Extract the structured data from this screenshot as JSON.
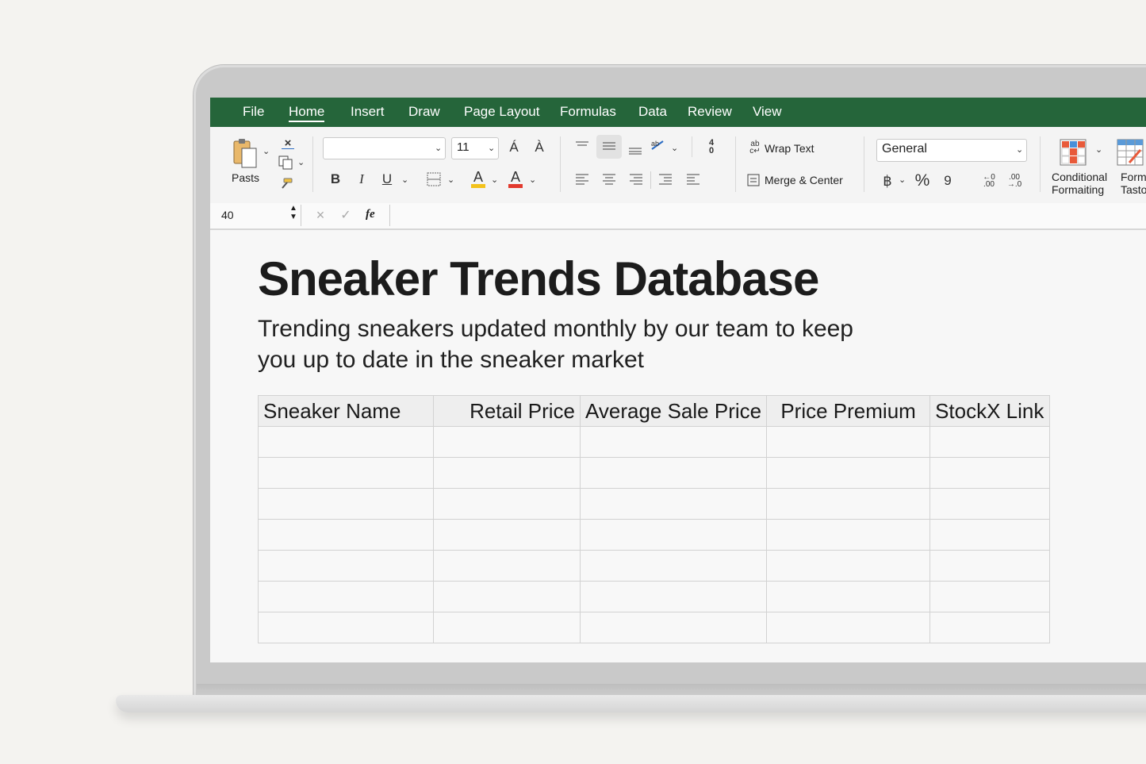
{
  "menu": {
    "tabs": [
      {
        "label": "File"
      },
      {
        "label": "Home"
      },
      {
        "label": "Insert"
      },
      {
        "label": "Draw"
      },
      {
        "label": "Page Layout"
      },
      {
        "label": "Formulas"
      },
      {
        "label": "Data"
      },
      {
        "label": "Review"
      },
      {
        "label": "View"
      }
    ],
    "active_tab": "Home"
  },
  "ribbon": {
    "paste_label": "Pasts",
    "font_name": "",
    "font_size": "11",
    "wrap_text_label": "Wrap Text",
    "merge_center_label": "Merge & Center",
    "number_format": "General",
    "percent_symbol": "%",
    "comma_symbol": "9",
    "conditional_formatting_line1": "Conditional",
    "conditional_formatting_line2": "Formaiting",
    "format_table_line1": "Form",
    "format_table_line2": "Tasto"
  },
  "formula_bar": {
    "name_box": "40",
    "fx_label": "fe",
    "value": ""
  },
  "sheet": {
    "title": "Sneaker Trends Database",
    "subtitle": "Trending sneakers updated monthly by our team to keep you up to date in the sneaker market",
    "columns": [
      {
        "label": "Sneaker Name"
      },
      {
        "label": "Retail Price"
      },
      {
        "label": "Average Sale Price"
      },
      {
        "label": "Price Premium"
      },
      {
        "label": "StockX Link"
      }
    ],
    "empty_rows": 7
  },
  "colors": {
    "menu_green": "#25653a",
    "font_color_red": "#e23a2e",
    "highlight_yellow": "#f3c21b"
  }
}
